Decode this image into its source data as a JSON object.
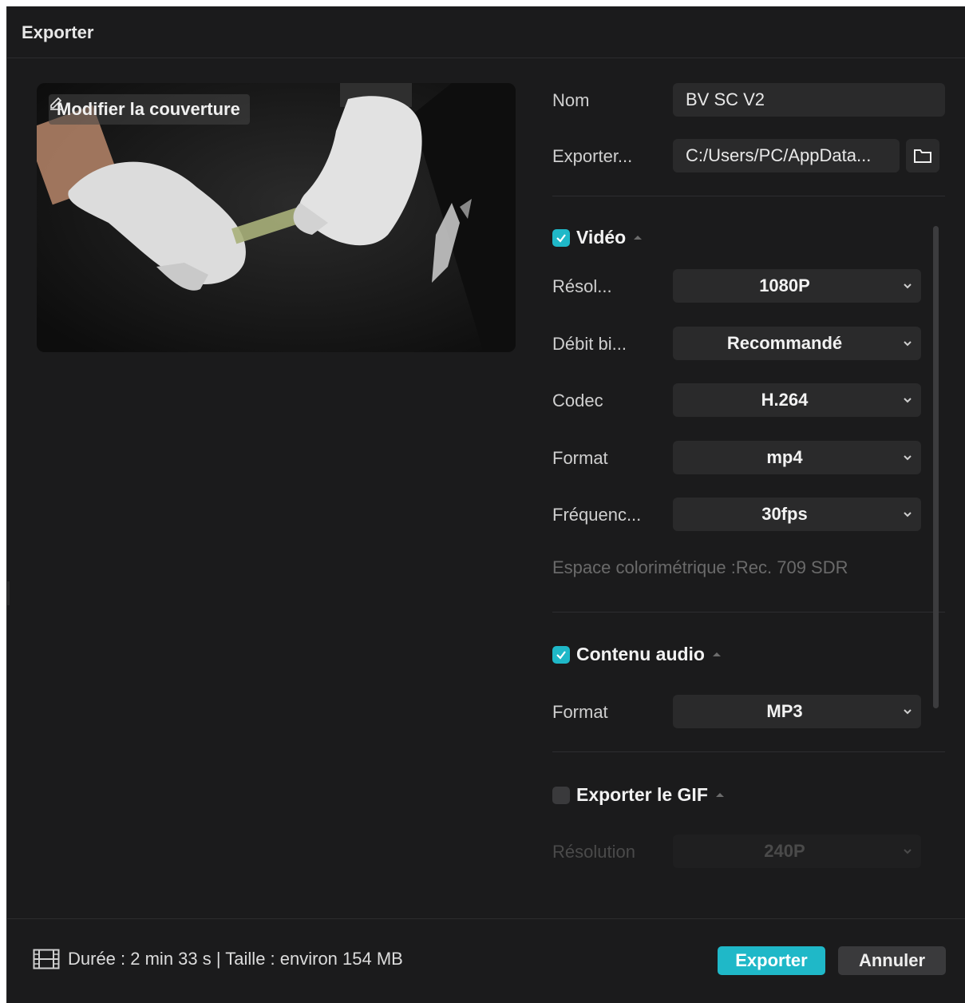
{
  "dialog": {
    "title": "Exporter"
  },
  "cover": {
    "edit_label": "Modifier la couverture"
  },
  "fields": {
    "name_label": "Nom",
    "name_value": "BV SC V2",
    "export_label": "Exporter...",
    "export_path": "C:/Users/PC/AppData..."
  },
  "video": {
    "section_label": "Vidéo",
    "checked": true,
    "resolution_label": "Résol...",
    "resolution_value": "1080P",
    "bitrate_label": "Débit bi...",
    "bitrate_value": "Recommandé",
    "codec_label": "Codec",
    "codec_value": "H.264",
    "format_label": "Format",
    "format_value": "mp4",
    "framerate_label": "Fréquenc...",
    "framerate_value": "30fps",
    "color_space": "Espace colorimétrique :Rec. 709 SDR"
  },
  "audio": {
    "section_label": "Contenu audio",
    "checked": true,
    "format_label": "Format",
    "format_value": "MP3"
  },
  "gif": {
    "section_label": "Exporter le GIF",
    "checked": false,
    "resolution_label": "Résolution",
    "resolution_value": "240P"
  },
  "footer": {
    "info": "Durée : 2 min 33 s | Taille : environ 154 MB",
    "export_button": "Exporter",
    "cancel_button": "Annuler"
  },
  "colors": {
    "accent": "#1fb8c8",
    "background": "#1b1b1c",
    "field": "#2a2a2b"
  }
}
